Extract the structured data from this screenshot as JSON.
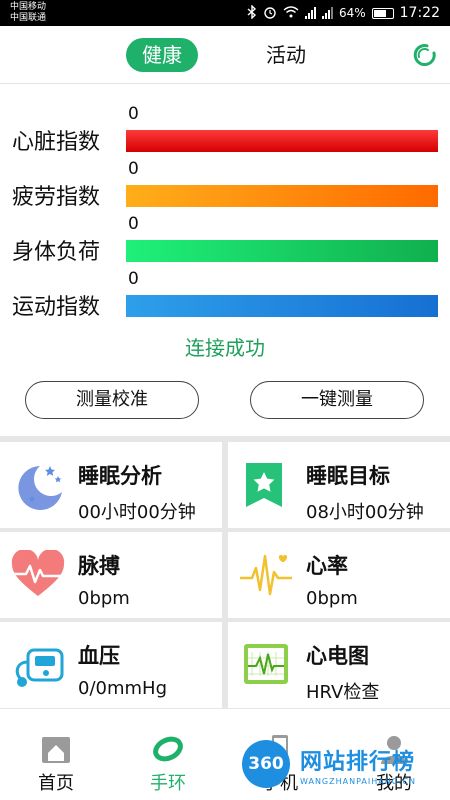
{
  "status_bar": {
    "carrier1": "中国移动",
    "carrier2": "中国联通",
    "battery": "64%",
    "time": "17:22"
  },
  "header": {
    "tabs": [
      {
        "label": "健康",
        "active": true
      },
      {
        "label": "活动",
        "active": false
      }
    ]
  },
  "indices": [
    {
      "label": "心脏指数",
      "value": "0",
      "colors": [
        "#ff2a2a",
        "#d90000"
      ]
    },
    {
      "label": "疲劳指数",
      "value": "0",
      "colors": [
        "#ffa81a",
        "#ff6a00"
      ]
    },
    {
      "label": "身体负荷",
      "value": "0",
      "colors": [
        "#1fe673",
        "#12b450"
      ]
    },
    {
      "label": "运动指数",
      "value": "0",
      "colors": [
        "#2c9be8",
        "#1a74d6"
      ]
    }
  ],
  "connection_status": "连接成功",
  "buttons": {
    "calibrate": "测量校准",
    "measure": "一键测量"
  },
  "cards": [
    {
      "title": "睡眠分析",
      "value": "00小时00分钟",
      "icon": "moon-stars-icon"
    },
    {
      "title": "睡眠目标",
      "value": "08小时00分钟",
      "icon": "star-bookmark-icon"
    },
    {
      "title": "脉搏",
      "value": "0bpm",
      "icon": "heart-pulse-icon"
    },
    {
      "title": "心率",
      "value": "0bpm",
      "icon": "heartbeat-wave-icon"
    },
    {
      "title": "血压",
      "value": "0/0mmHg",
      "icon": "blood-pressure-icon"
    },
    {
      "title": "心电图",
      "value": "HRV检查",
      "icon": "ecg-monitor-icon"
    }
  ],
  "nav": [
    {
      "label": "首页",
      "icon": "home-icon",
      "active": false
    },
    {
      "label": "手环",
      "icon": "band-icon",
      "active": true
    },
    {
      "label": "手机",
      "icon": "phone-icon",
      "active": false
    },
    {
      "label": "我的",
      "icon": "user-icon",
      "active": false
    }
  ],
  "watermark": {
    "badge": "360",
    "title": "网站排行榜",
    "subtitle": "WANGZHANPAIHANG.CN"
  },
  "colors": {
    "accent": "#1fb06a",
    "connected": "#1f9e5c",
    "card_gap": "#e6e6e6"
  }
}
